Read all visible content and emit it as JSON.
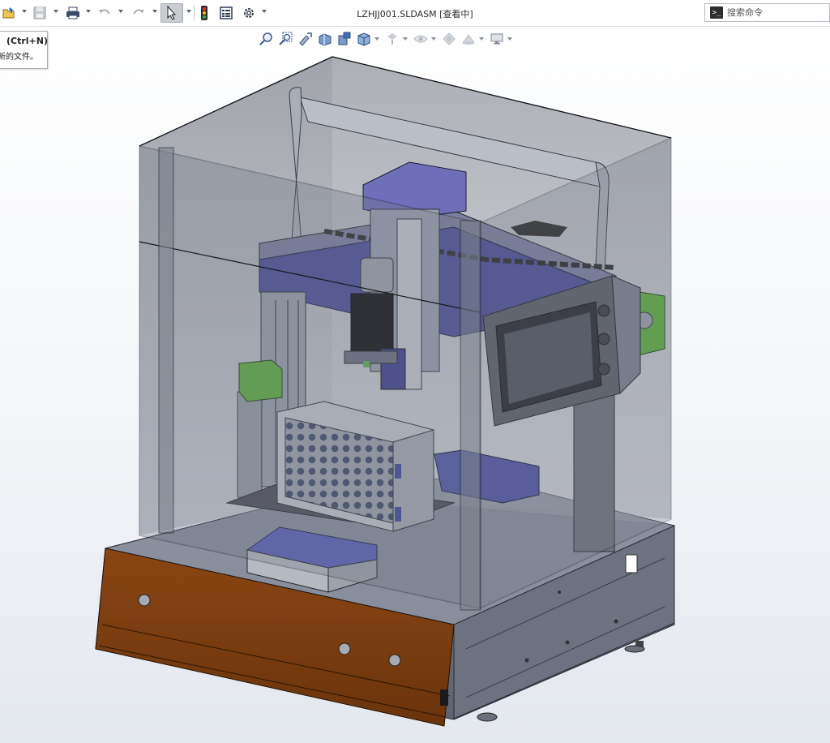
{
  "app": {
    "document_title": "LZHJJ001.SLDASM [查看中]"
  },
  "toolbar": {
    "items": [
      {
        "name": "open-icon"
      },
      {
        "name": "save-icon"
      },
      {
        "name": "print-icon"
      },
      {
        "name": "undo-icon"
      },
      {
        "name": "redo-icon"
      },
      {
        "name": "select-arrow-icon",
        "active": true
      },
      {
        "name": "rebuild-traffic-light-icon"
      },
      {
        "name": "file-properties-icon"
      },
      {
        "name": "options-gear-icon"
      }
    ]
  },
  "search": {
    "placeholder": "搜索命令",
    "icon": "command-prompt-icon",
    "icon_glyph": ">_"
  },
  "tooltip": {
    "shortcut": "(Ctrl+N)",
    "description": "新的文件。"
  },
  "view_toolbar": {
    "items": [
      "zoom-to-fit-icon",
      "zoom-to-area-icon",
      "previous-view-icon",
      "section-view-icon",
      "dynamic-annotation-views-icon",
      "view-orientation-icon",
      "display-style-icon",
      "hide-show-items-icon",
      "edit-appearance-icon",
      "apply-scene-icon",
      "view-settings-icon"
    ]
  },
  "colors": {
    "enclosure_glass": "#5a5f6a",
    "base_frame": "#6f7482",
    "front_panel": "#7a3d10",
    "gantry_blue": "#4d4f9a",
    "hmi_panel": "#5c6068",
    "green_part": "#5fae3f"
  }
}
